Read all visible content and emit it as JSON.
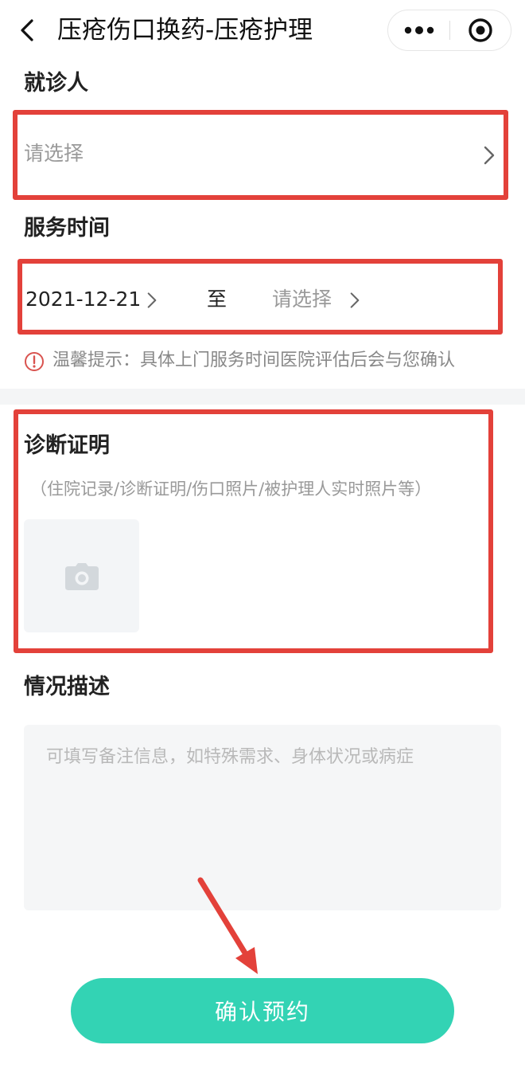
{
  "header": {
    "title": "压疮伤口换药-压疮护理",
    "back_icon": "chevron-left-icon",
    "more_icon": "more-dots-icon",
    "close_icon": "target-circle-icon"
  },
  "patient": {
    "label": "就诊人",
    "placeholder": "请选择"
  },
  "service_time": {
    "label": "服务时间",
    "start_value": "2021-12-21",
    "separator": "至",
    "end_placeholder": "请选择",
    "tip": "温馨提示：具体上门服务时间医院评估后会与您确认"
  },
  "diagnosis": {
    "label": "诊断证明",
    "hint": "（住院记录/诊断证明/伤口照片/被护理人实时照片等）",
    "upload_icon": "camera-icon"
  },
  "description": {
    "label": "情况描述",
    "placeholder": "可填写备注信息，如特殊需求、身体状况或病症",
    "value": ""
  },
  "confirm_label": "确认预约",
  "colors": {
    "accent": "#33d3b4",
    "annotation_red": "#e3413a",
    "placeholder": "#9a9a9a",
    "tip_icon": "#d9534f"
  }
}
